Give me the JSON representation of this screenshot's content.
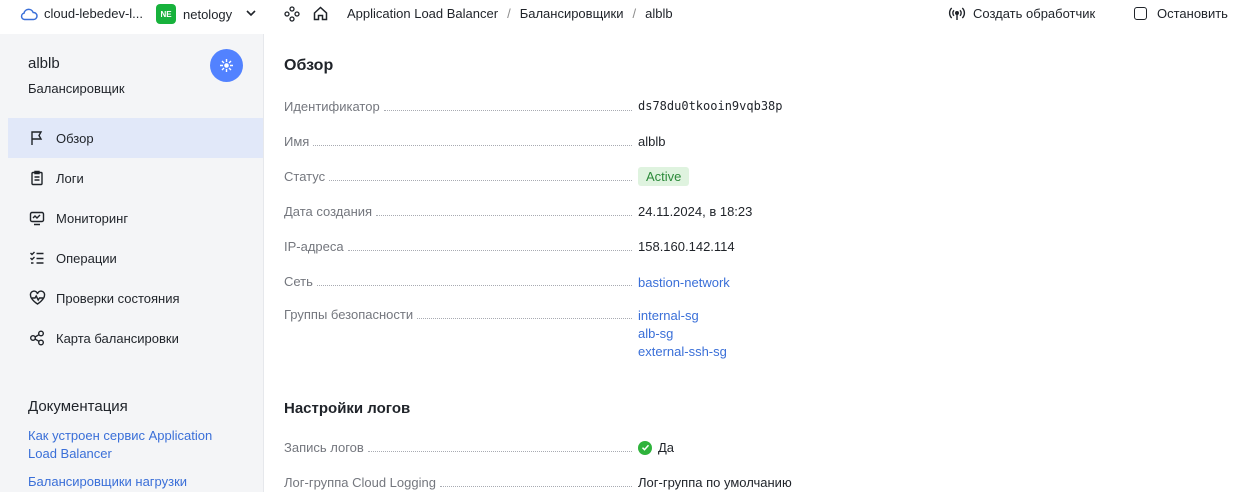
{
  "topbar": {
    "cloud_name": "cloud-lebedev-l...",
    "org_badge": "NE",
    "org_name": "netology",
    "breadcrumbs": [
      "Application Load Balancer",
      "Балансировщики",
      "alblb"
    ],
    "create_handler_label": "Создать обработчик",
    "stop_label": "Остановить"
  },
  "sidebar": {
    "title": "alblb",
    "subtitle": "Балансировщик",
    "items": [
      {
        "label": "Обзор",
        "icon": "flag-icon",
        "active": true
      },
      {
        "label": "Логи",
        "icon": "clipboard-icon",
        "active": false
      },
      {
        "label": "Мониторинг",
        "icon": "monitor-icon",
        "active": false
      },
      {
        "label": "Операции",
        "icon": "list-checks-icon",
        "active": false
      },
      {
        "label": "Проверки состояния",
        "icon": "heartbeat-icon",
        "active": false
      },
      {
        "label": "Карта балансировки",
        "icon": "share-nodes-icon",
        "active": false
      }
    ],
    "docs_title": "Документация",
    "docs_links": [
      "Как устроен сервис Application Load Balancer",
      "Балансировщики нагрузки"
    ]
  },
  "overview": {
    "heading": "Обзор",
    "fields": {
      "id_label": "Идентификатор",
      "id_value": "ds78du0tkooin9vqb38p",
      "name_label": "Имя",
      "name_value": "alblb",
      "status_label": "Статус",
      "status_value": "Active",
      "created_label": "Дата создания",
      "created_value": "24.11.2024, в 18:23",
      "ip_label": "IP-адреса",
      "ip_value": "158.160.142.114",
      "network_label": "Сеть",
      "network_value": "bastion-network",
      "sg_label": "Группы безопасности",
      "sg_values": [
        "internal-sg",
        "alb-sg",
        "external-ssh-sg"
      ]
    }
  },
  "logs": {
    "heading": "Настройки логов",
    "write_label": "Запись логов",
    "write_value": "Да",
    "group_label": "Лог-группа Cloud Logging",
    "group_value": "Лог-группа по умолчанию"
  },
  "colors": {
    "accent": "#5282ff",
    "link": "#3a6fd8",
    "org_badge": "#17b23c",
    "status_active_bg": "#dff3df",
    "status_active_text": "#2c8a3a",
    "sidebar_active": "#e1e8f9"
  }
}
